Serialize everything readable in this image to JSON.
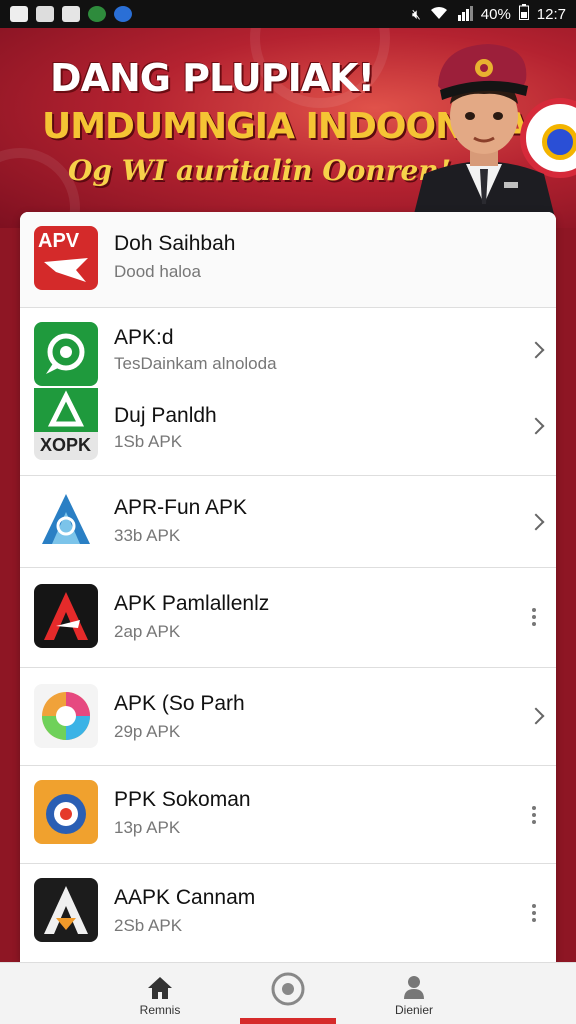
{
  "status_bar": {
    "battery": "40%",
    "time": "12:7"
  },
  "banner": {
    "title": "DANG PLUPIAK!",
    "subtitle": "UMDUMNGIA INDOONSIA",
    "tagline": "Og WI auritalin Oonren!"
  },
  "header_item": {
    "icon_text": "APV",
    "title": "Doh Saihbah",
    "subtitle": "Dood haloa"
  },
  "apps": [
    {
      "title": "APK:d",
      "subtitle": "TesDainkam alnoloda",
      "action": "chevron",
      "icon_name": "green-speech-icon"
    },
    {
      "title": "Duj Panldh",
      "subtitle": "1Sb APK",
      "action": "chevron",
      "icon_name": "xopk-icon",
      "icon_text": "XOPK"
    },
    {
      "title": "APR-Fun APK",
      "subtitle": "33b APK",
      "action": "chevron",
      "icon_name": "blue-prism-icon"
    },
    {
      "title": "APK Pamlallenlz",
      "subtitle": "2ap APK",
      "action": "more",
      "icon_name": "red-a-icon"
    },
    {
      "title": "APK (So Parh",
      "subtitle": "29p APK",
      "action": "chevron",
      "icon_name": "rainbow-swirl-icon"
    },
    {
      "title": "PPK Sokoman",
      "subtitle": "13p APK",
      "action": "more",
      "icon_name": "orange-badge-icon"
    },
    {
      "title": "AAPK Cannam",
      "subtitle": "2Sb APK",
      "action": "more",
      "icon_name": "dark-a-icon"
    }
  ],
  "bottom_nav": {
    "items": [
      {
        "label": "Remnis",
        "icon": "home-icon"
      },
      {
        "label": "",
        "icon": "record-icon"
      },
      {
        "label": "Dienier",
        "icon": "person-icon"
      }
    ]
  },
  "colors": {
    "accent": "#d62a2a",
    "banner_bg": "#b42230",
    "banner_title": "#ffffff",
    "banner_subtitle": "#f5c434"
  }
}
